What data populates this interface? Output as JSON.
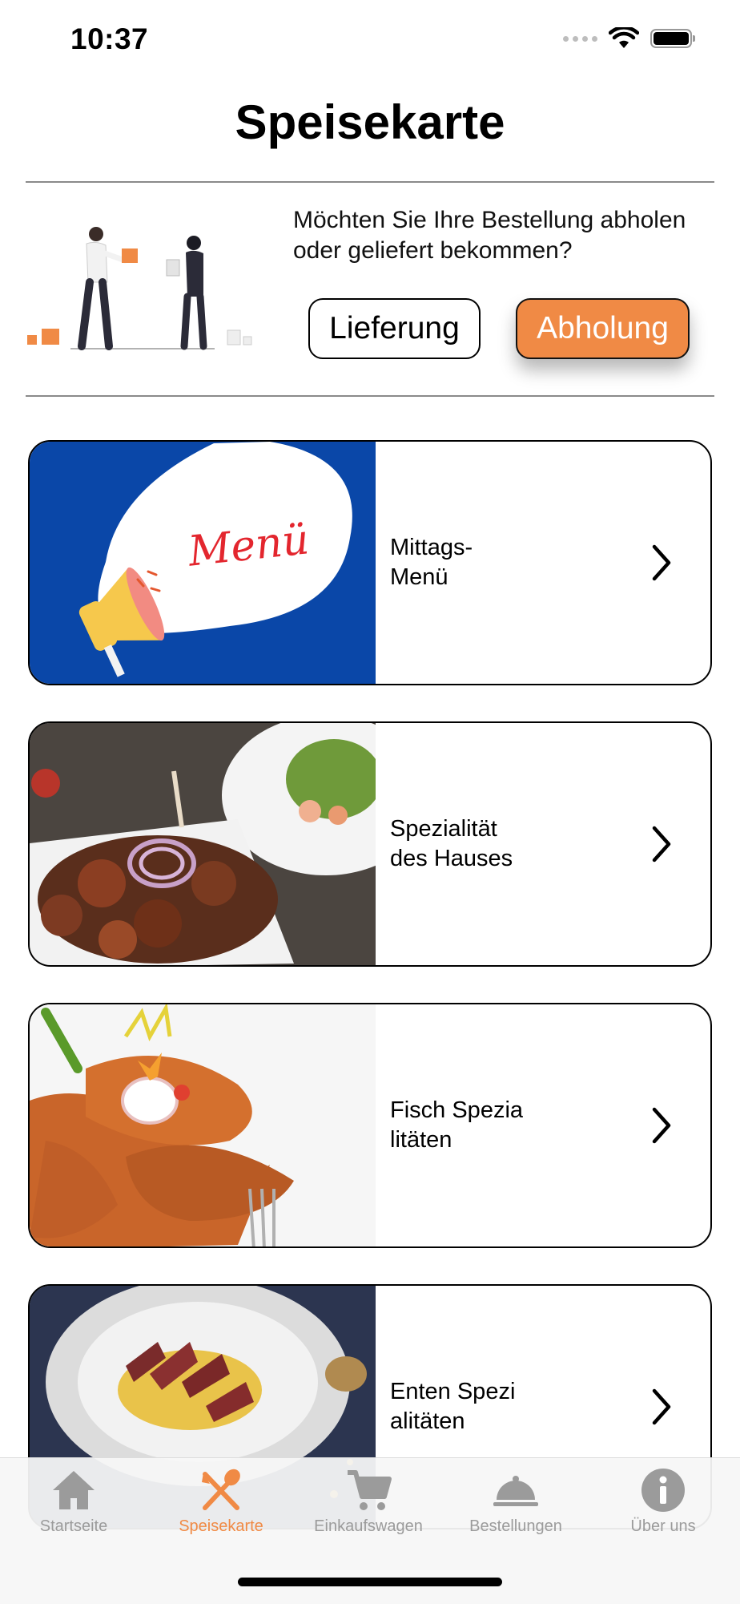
{
  "status_bar": {
    "time": "10:37"
  },
  "header": {
    "title": "Speisekarte"
  },
  "delivery": {
    "question": "Möchten Sie Ihre Bestellung abholen oder geliefert bekommen?",
    "delivery_label": "Lieferung",
    "pickup_label": "Abholung",
    "selected": "Abholung"
  },
  "categories": [
    {
      "label": "Mittags-\nMenü",
      "image_text": "Menü"
    },
    {
      "label": "Spezialität\ndes Hauses"
    },
    {
      "label": "Fisch Spezia\nlitäten"
    },
    {
      "label": "Enten Spezi\nalitäten"
    }
  ],
  "tabs": [
    {
      "label": "Startseite",
      "icon": "home-icon"
    },
    {
      "label": "Speisekarte",
      "icon": "utensils-icon",
      "active": true
    },
    {
      "label": "Einkaufswagen",
      "icon": "cart-icon"
    },
    {
      "label": "Bestellungen",
      "icon": "cloche-icon"
    },
    {
      "label": "Über uns",
      "icon": "info-icon"
    }
  ],
  "colors": {
    "accent": "#f08a45",
    "menu_banner": "#0a47a8",
    "inactive": "#9b9b9b"
  }
}
